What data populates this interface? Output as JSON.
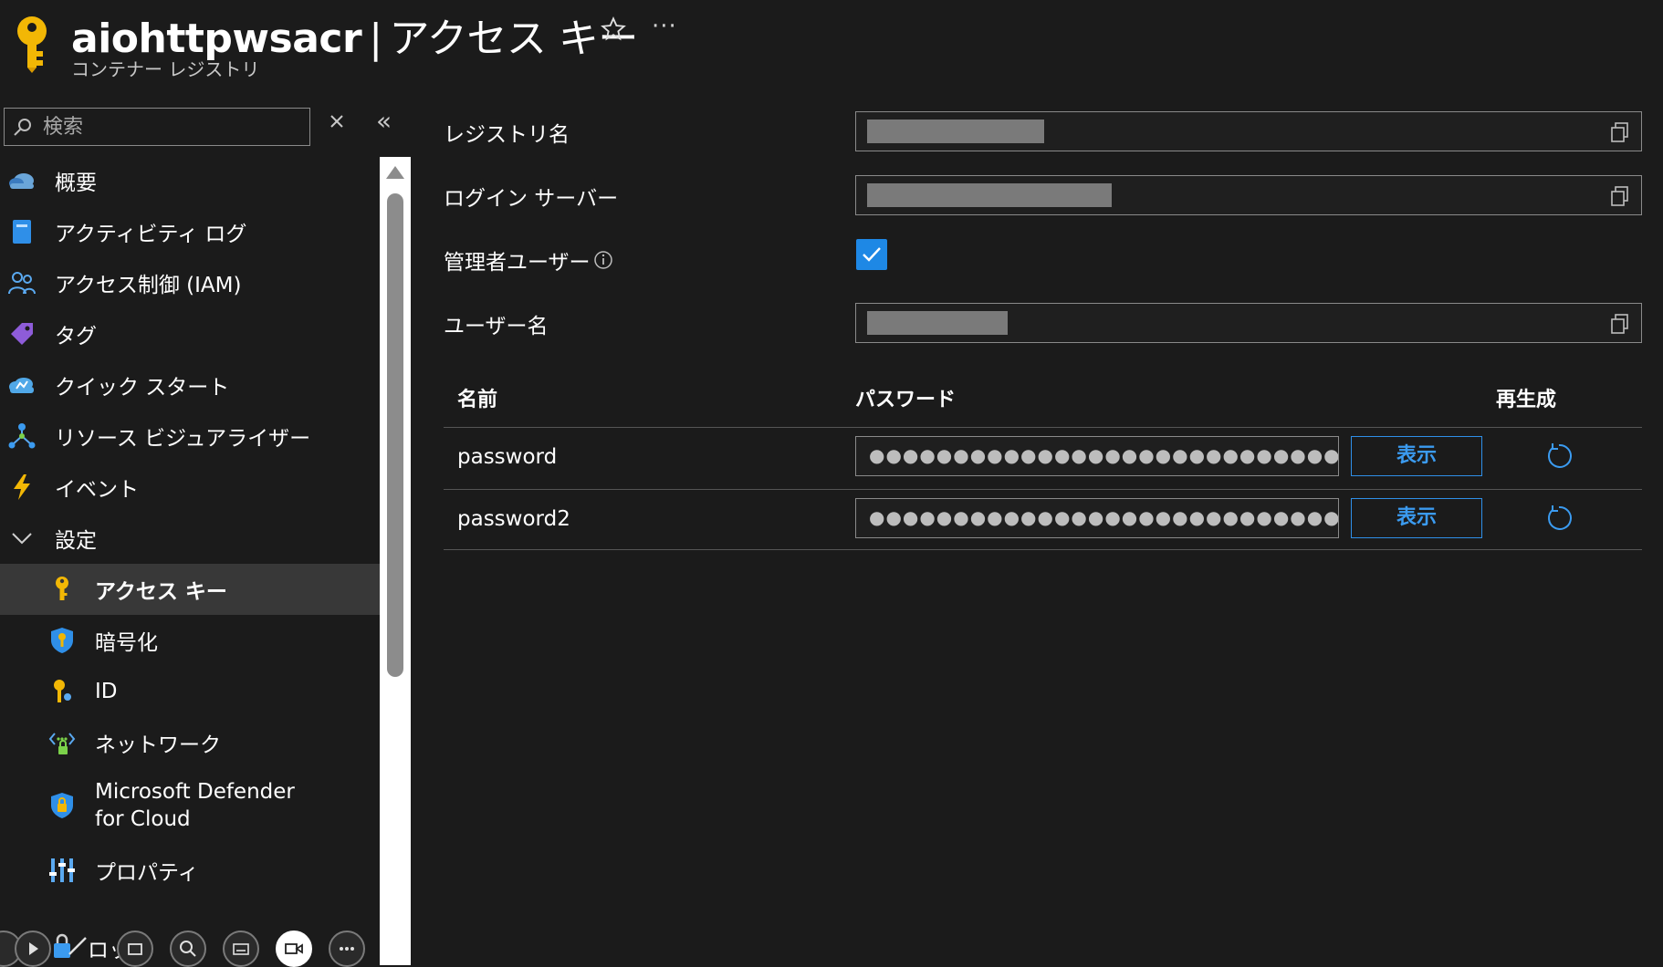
{
  "header": {
    "resource_name": "aiohttpwsacr",
    "separator": "|",
    "page_title": "アクセス キー",
    "subtitle": "コンテナー レジストリ",
    "more_label": "···"
  },
  "sidebar": {
    "search_placeholder": "検索",
    "collapse_label": "«",
    "items": [
      {
        "label": "概要",
        "icon": "overview-cloud-icon"
      },
      {
        "label": "アクティビティ ログ",
        "icon": "activity-log-icon"
      },
      {
        "label": "アクセス制御 (IAM)",
        "icon": "iam-people-icon"
      },
      {
        "label": "タグ",
        "icon": "tag-icon"
      },
      {
        "label": "クイック スタート",
        "icon": "quickstart-cloud-icon"
      },
      {
        "label": "リソース ビジュアライザー",
        "icon": "resource-visualizer-icon"
      },
      {
        "label": "イベント",
        "icon": "lightning-icon"
      },
      {
        "label": "設定",
        "icon": "chevron-down-icon"
      },
      {
        "label": "アクセス キー",
        "icon": "key-icon"
      },
      {
        "label": "暗号化",
        "icon": "shield-key-icon"
      },
      {
        "label": "ID",
        "icon": "identity-key-icon"
      },
      {
        "label": "ネットワーク",
        "icon": "network-icon"
      },
      {
        "label": "Microsoft Defender for Cloud",
        "icon": "defender-shield-icon"
      },
      {
        "label": "プロパティ",
        "icon": "properties-icon"
      }
    ],
    "lock_label": "ロック"
  },
  "main": {
    "registry_name_label": "レジストリ名",
    "login_server_label": "ログイン サーバー",
    "admin_user_label": "管理者ユーザー",
    "admin_user_checked": true,
    "username_label": "ユーザー名",
    "table": {
      "col_name": "名前",
      "col_password": "パスワード",
      "col_regenerate": "再生成",
      "rows": [
        {
          "name": "password",
          "value": "●●●●●●●●●●●●●●●●●●●●●●●●●●●●●●●●●●●●●●···",
          "show_label": "表示"
        },
        {
          "name": "password2",
          "value": "●●●●●●●●●●●●●●●●●●●●●●●●●●●●●●●●●●●●●●···",
          "show_label": "表示"
        }
      ]
    }
  },
  "colors": {
    "background": "#1b1b1b",
    "active_item": "#383838",
    "accent_blue": "#1e88e5",
    "link_blue": "#3b9bf0",
    "key_gold": "#f2b705"
  }
}
